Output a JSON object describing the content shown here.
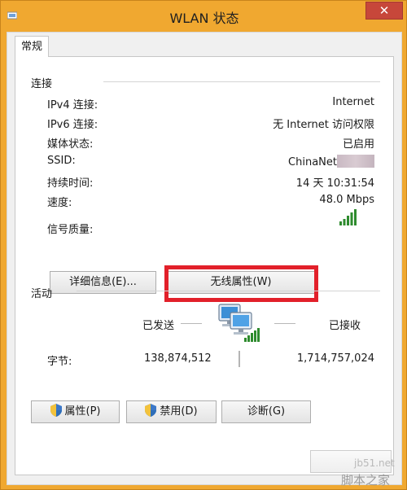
{
  "window": {
    "title": "WLAN 状态",
    "close_glyph": "✕"
  },
  "tabs": [
    {
      "label": "常规"
    }
  ],
  "connection": {
    "group_title": "连接",
    "rows": [
      {
        "label": "IPv4 连接:",
        "value": "Internet"
      },
      {
        "label": "IPv6 连接:",
        "value": "无 Internet 访问权限"
      },
      {
        "label": "媒体状态:",
        "value": "已启用"
      },
      {
        "label": "SSID:",
        "value": "ChinaNet"
      },
      {
        "label": "持续时间:",
        "value": "14 天 10:31:54"
      },
      {
        "label": "速度:",
        "value": "48.0 Mbps"
      },
      {
        "label": "信号质量:",
        "value": ""
      }
    ],
    "signal_bars": 5,
    "details_button": "详细信息(E)...",
    "wireless_props_button": "无线属性(W)"
  },
  "activity": {
    "group_title": "活动",
    "sent_label": "已发送",
    "received_label": "已接收",
    "bytes_label": "字节:",
    "bytes_sent": "138,874,512",
    "bytes_received": "1,714,757,024"
  },
  "buttons": {
    "properties": "属性(P)",
    "disable": "禁用(D)",
    "diagnose": "诊断(G)"
  },
  "watermark": {
    "site": "jb51.net",
    "brand": "脚本之家"
  },
  "colors": {
    "titlebar": "#f0a830",
    "close": "#c7473a",
    "highlight": "#e2202a",
    "signal": "#2e8b2e"
  }
}
